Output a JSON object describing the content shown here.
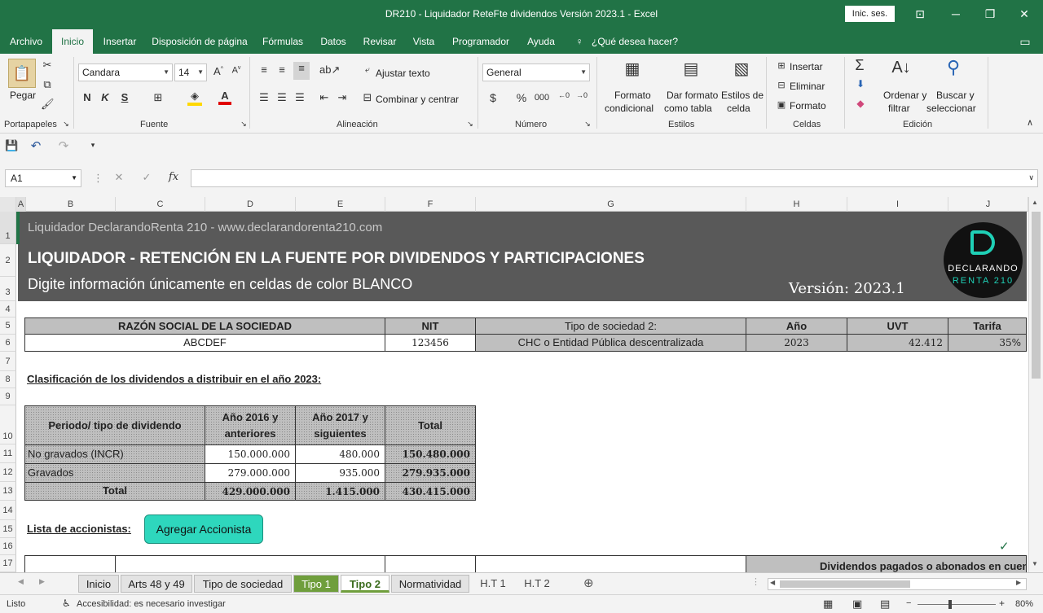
{
  "window": {
    "title": "DR210 - Liquidador ReteFte dividendos Versión 2023.1  -  Excel",
    "signin": "Inic. ses."
  },
  "menu": {
    "tabs": [
      "Archivo",
      "Inicio",
      "Insertar",
      "Disposición de página",
      "Fórmulas",
      "Datos",
      "Revisar",
      "Vista",
      "Programador",
      "Ayuda",
      "¿Qué desea hacer?"
    ],
    "active": "Inicio"
  },
  "ribbon": {
    "clipboard": {
      "paste": "Pegar",
      "label": "Portapapeles"
    },
    "font": {
      "name": "Candara",
      "size": "14",
      "bold": "N",
      "italic": "K",
      "underline": "S",
      "label": "Fuente"
    },
    "alignment": {
      "wrap": "Ajustar texto",
      "merge": "Combinar y centrar",
      "label": "Alineación"
    },
    "number": {
      "format": "General",
      "currency": "$",
      "percent": "%",
      "thousands": "000",
      "label": "Número"
    },
    "styles": {
      "conditional1": "Formato",
      "conditional2": "condicional",
      "table1": "Dar formato",
      "table2": "como tabla",
      "cell1": "Estilos de",
      "cell2": "celda",
      "label": "Estilos"
    },
    "cells": {
      "insert": "Insertar",
      "delete": "Eliminar",
      "format": "Formato",
      "label": "Celdas"
    },
    "editing": {
      "sort1": "Ordenar y",
      "sort2": "filtrar",
      "find1": "Buscar y",
      "find2": "seleccionar",
      "label": "Edición"
    }
  },
  "formula_bar": {
    "name_box": "A1",
    "fx": "fx",
    "value": ""
  },
  "columns": [
    "A",
    "B",
    "C",
    "D",
    "E",
    "F",
    "G",
    "H",
    "I",
    "J"
  ],
  "rows": [
    "1",
    "2",
    "3",
    "4",
    "5",
    "6",
    "7",
    "8",
    "9",
    "10",
    "11",
    "12",
    "13",
    "14",
    "15",
    "16",
    "17"
  ],
  "banner": {
    "site": "Liquidador DeclarandoRenta 210 - www.declarandorenta210.com",
    "title": "LIQUIDADOR - RETENCIÓN EN LA FUENTE POR DIVIDENDOS Y PARTICIPACIONES",
    "subtitle": "Digite información únicamente en celdas de color BLANCO",
    "version": "Versión: 2023.1",
    "logo_line1": "DECLARANDO",
    "logo_line2": "RENTA 210"
  },
  "company": {
    "headers": [
      "RAZÓN SOCIAL DE LA SOCIEDAD",
      "NIT",
      "Tipo de sociedad 2:",
      "Año",
      "UVT",
      "Tarifa"
    ],
    "values": [
      "ABCDEF",
      "123456",
      "CHC o Entidad Pública descentralizada",
      "2023",
      "42.412",
      "35%"
    ]
  },
  "classification": {
    "label": "Clasificación de los dividendos a distribuir en el año 2023:",
    "headers": [
      "Periodo/ tipo de dividendo",
      "Año 2016 y",
      "anteriores",
      "Año 2017 y",
      "siguientes",
      "Total"
    ],
    "rows": [
      {
        "name": "No gravados (INCR)",
        "y2016": "150.000.000",
        "y2017": "480.000",
        "total": "150.480.000"
      },
      {
        "name": "Gravados",
        "y2016": "279.000.000",
        "y2017": "935.000",
        "total": "279.935.000"
      },
      {
        "name": "Total",
        "y2016": "429.000.000",
        "y2017": "1.415.000",
        "total": "430.415.000"
      }
    ]
  },
  "shareholders": {
    "label": "Lista de accionistas:",
    "add_button": "Agregar Accionista",
    "partial_header": "Dividendos pagados o abonados en cuenta e"
  },
  "sheet_tabs": [
    "Inicio",
    "Arts 48 y 49",
    "Tipo de sociedad",
    "Tipo 1",
    "Tipo 2",
    "Normatividad",
    "H.T 1",
    "H.T 2"
  ],
  "active_sheet": "Tipo 2",
  "status": {
    "ready": "Listo",
    "accessibility": "Accesibilidad: es necesario investigar",
    "zoom": "80%"
  }
}
